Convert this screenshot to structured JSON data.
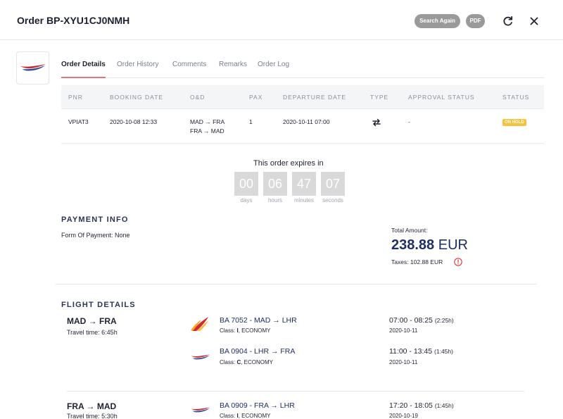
{
  "header": {
    "title": "Order BP-XYU1CJ0NMH",
    "search_again": "Search Again",
    "pdf": "PDF"
  },
  "tabs": [
    "Order Details",
    "Order History",
    "Comments",
    "Remarks",
    "Order Log"
  ],
  "table": {
    "headers": [
      "PNR",
      "BOOKING DATE",
      "O&D",
      "PAX",
      "DEPARTURE DATE",
      "TYPE",
      "APPROVAL STATUS",
      "STATUS"
    ],
    "row": {
      "pnr": "VPIAT3",
      "booking_date": "2020-10-08 12:33",
      "od": [
        "MAD → FRA",
        "FRA → MAD"
      ],
      "pax": "1",
      "departure_date": "2020-10-11 07:00",
      "type_icon": "round-trip-arrows-icon",
      "approval_status": "-",
      "status": "ON HOLD"
    }
  },
  "countdown": {
    "label": "This order expires in",
    "values": [
      "00",
      "06",
      "47",
      "07"
    ],
    "units": [
      "days",
      "hours",
      "minutes",
      "seconds"
    ]
  },
  "payment": {
    "title": "PAYMENT INFO",
    "form_of_payment": "Form Of Payment: None",
    "total_label": "Total Amount:",
    "total_value": "238.88",
    "currency": "EUR",
    "taxes": "Taxes: 102.88 EUR"
  },
  "flights": {
    "title": "FLIGHT DETAILS",
    "journeys": [
      {
        "route": "MAD → FRA",
        "travel_time": "Travel time: 6:45h",
        "segments": [
          {
            "airline": "iberia-logo",
            "flight": "BA 7052 - MAD → LHR",
            "class_code": "I",
            "cabin": ", ECONOMY",
            "time": "07:00 - 08:25",
            "duration": "(2:25h)",
            "date": "2020-10-11"
          },
          {
            "airline": "british-airways-logo",
            "flight": "BA 0904 - LHR → FRA",
            "class_code": "C",
            "cabin": ", ECONOMY",
            "time": "11:00 - 13:45",
            "duration": "(1:45h)",
            "date": "2020-10-11"
          }
        ]
      },
      {
        "route": "FRA → MAD",
        "travel_time": "Travel time: 5:30h",
        "segments": [
          {
            "airline": "british-airways-logo",
            "flight": "BA 0909 - FRA → LHR",
            "class_code": "I",
            "cabin": ", ECONOMY",
            "time": "17:20 - 18:05",
            "duration": "(1:45h)",
            "date": "2020-10-19"
          }
        ]
      }
    ]
  },
  "class_prefix": "Class: ",
  "colors": {
    "accent": "#e4737a",
    "navy": "#1e2f63",
    "on_hold": "#f7c23a",
    "pill": "#9a9a9a"
  }
}
